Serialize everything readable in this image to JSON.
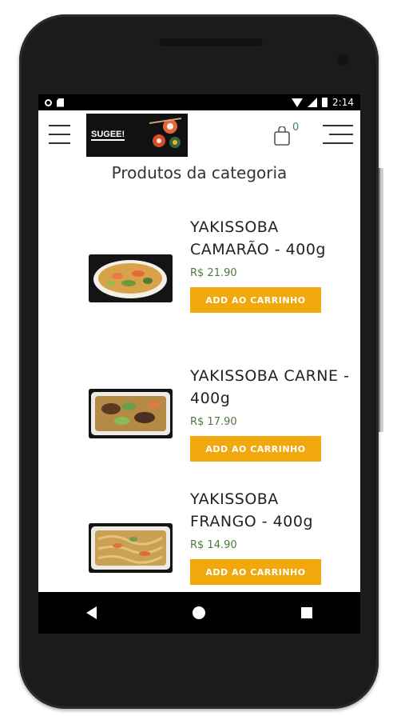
{
  "status_bar": {
    "time": "2:14"
  },
  "header": {
    "logo_text": "SUGEE!",
    "cart_count": "0"
  },
  "section_title": "Produtos da categoria",
  "products": [
    {
      "name": "YAKISSOBA CAMARÃO - 400g",
      "price": "R$ 21.90",
      "button": "ADD AO CARRINHO"
    },
    {
      "name": "YAKISSOBA CARNE - 400g",
      "price": "R$ 17.90",
      "button": "ADD AO CARRINHO"
    },
    {
      "name": "YAKISSOBA FRANGO - 400g",
      "price": "R$ 14.90",
      "button": "ADD AO CARRINHO"
    }
  ],
  "colors": {
    "accent": "#f0a80c",
    "price": "#4c7a3e",
    "cart_count": "#3a8a5a"
  },
  "icons": [
    "menu-icon",
    "cart-icon",
    "menu-lines-icon",
    "back-icon",
    "home-icon",
    "recent-apps-icon",
    "wifi-icon",
    "signal-icon",
    "battery-icon"
  ]
}
